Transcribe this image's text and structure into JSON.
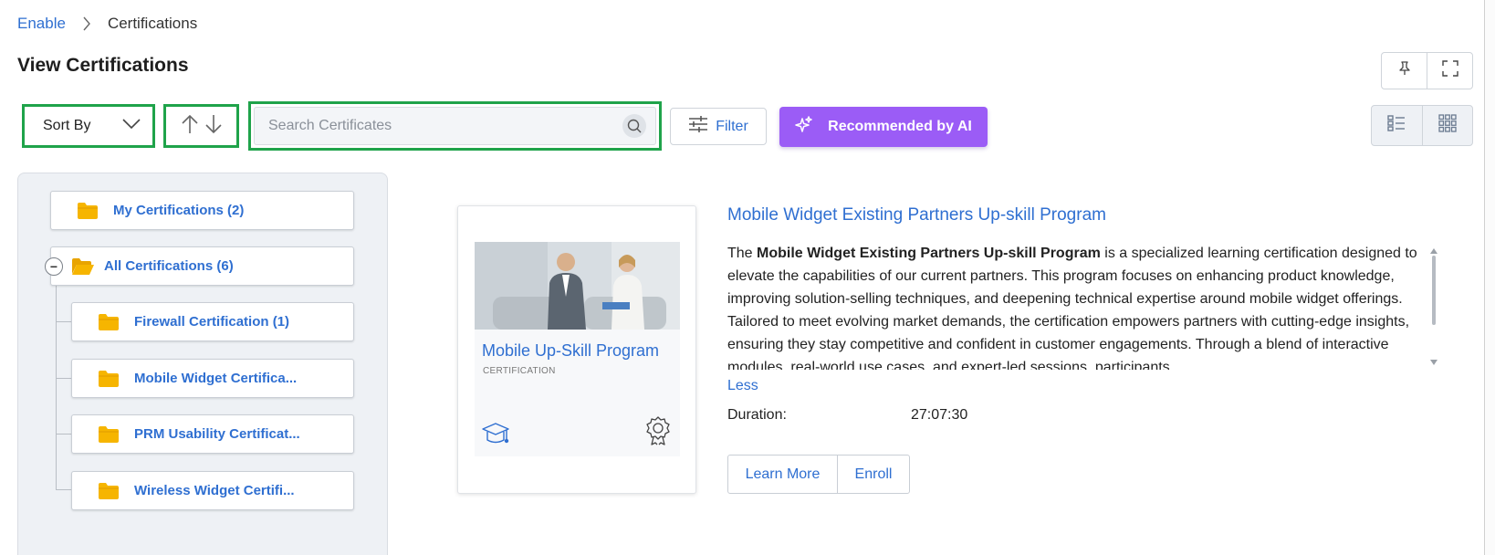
{
  "breadcrumb": {
    "parent": "Enable",
    "current": "Certifications"
  },
  "page": {
    "title": "View Certifications"
  },
  "toolbar": {
    "sort_label": "Sort By",
    "search_placeholder": "Search Certificates",
    "filter_label": "Filter",
    "ai_label": "Recommended by AI"
  },
  "folders": {
    "my": "My Certifications (2)",
    "all": "All Certifications (6)",
    "collapse_symbol": "−",
    "children": [
      "Firewall Certification (1)",
      "Mobile Widget Certifica...",
      "PRM Usability Certificat...",
      "Wireless Widget Certifi..."
    ]
  },
  "card": {
    "name": "Mobile Up-Skill Program",
    "type": "CERTIFICATION"
  },
  "detail": {
    "title": "Mobile Widget Existing Partners Up-skill Program",
    "desc_prefix": "The ",
    "desc_bold": "Mobile Widget Existing Partners Up-skill Program",
    "desc_rest": " is a specialized learning certification designed to elevate the capabilities of our current partners. This program focuses on enhancing product knowledge, improving solution-selling techniques, and deepening technical expertise around mobile widget offerings. Tailored to meet evolving market demands, the certification empowers partners with cutting-edge insights, ensuring they stay competitive and confident in customer engagements. Through a blend of interactive modules, real-world use cases, and expert-led sessions, participants",
    "less_label": "Less",
    "duration_label": "Duration:",
    "duration_value": "27:07:30",
    "learn_more_label": "Learn More",
    "enroll_label": "Enroll"
  },
  "colors": {
    "accent": "#2f6fd1",
    "ai_button": "#9b5cf6",
    "highlight": "#1fa34a",
    "folder": "#f6b500"
  },
  "icons": {
    "breadcrumb_separator": "chevron-right-icon",
    "pin": "pin-icon",
    "fullscreen": "fullscreen-icon",
    "sort_dropdown": "chevron-down-icon",
    "sort_asc": "arrow-up-icon",
    "sort_desc": "arrow-down-icon",
    "search": "search-icon",
    "filter": "sliders-icon",
    "ai": "sparkle-icon",
    "list_view": "list-view-icon",
    "grid_view": "grid-view-icon",
    "folder": "folder-icon",
    "graduation": "graduation-cap-icon",
    "badge": "award-badge-icon"
  }
}
